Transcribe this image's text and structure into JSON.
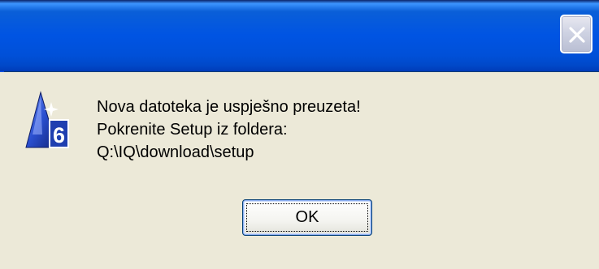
{
  "dialog": {
    "icon": "app-triangle-6-icon",
    "icon_badge": "6",
    "message_lines": [
      "Nova datoteka je uspješno preuzeta!",
      "Pokrenite Setup iz foldera:",
      "Q:\\IQ\\download\\setup"
    ],
    "ok_label": "OK"
  },
  "titlebar": {
    "close_icon": "close-icon"
  },
  "colors": {
    "titlebar": "#0054e3",
    "body": "#ece9d8",
    "icon_blue": "#1f3fb0"
  }
}
